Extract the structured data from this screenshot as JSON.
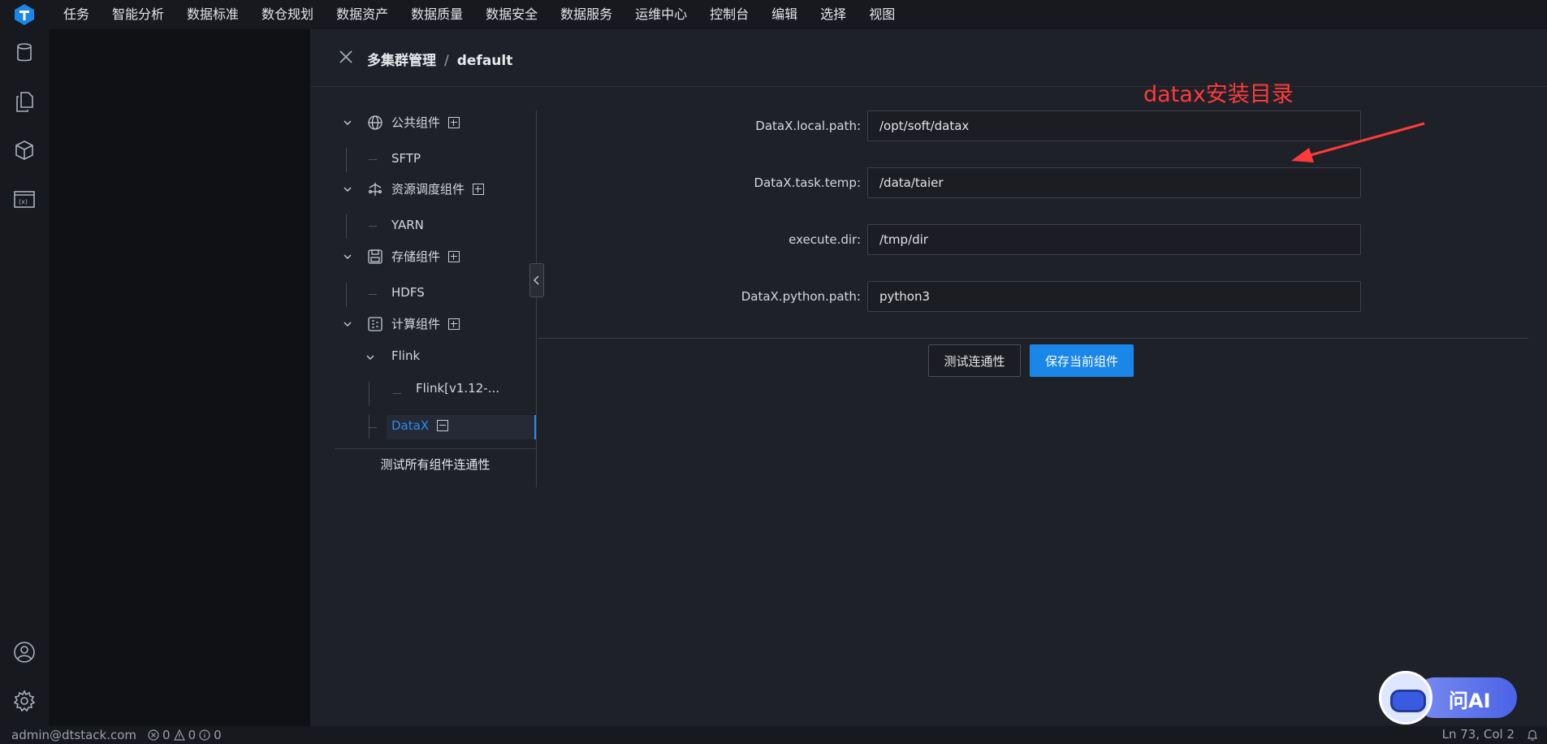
{
  "menubar": {
    "logo_icon": "taier-logo-icon",
    "items": [
      "任务",
      "智能分析",
      "数据标准",
      "数仓规划",
      "数据资产",
      "数据质量",
      "数据安全",
      "数据服务",
      "运维中心",
      "控制台",
      "编辑",
      "选择",
      "视图"
    ]
  },
  "activitybar": {
    "top_icons": [
      "database-icon",
      "files-icon",
      "package-icon",
      "variable-icon"
    ],
    "bottom_icons": [
      "account-icon",
      "settings-gear-icon"
    ]
  },
  "header": {
    "breadcrumb_root": "多集群管理",
    "breadcrumb_sep": "/",
    "breadcrumb_current": "default"
  },
  "tree": {
    "groups": [
      {
        "label": "公共组件",
        "icon": "globe-icon",
        "children": [
          "SFTP"
        ]
      },
      {
        "label": "资源调度组件",
        "icon": "resource-schedule-icon",
        "children": [
          "YARN"
        ]
      },
      {
        "label": "存储组件",
        "icon": "save-disk-icon",
        "children": [
          "HDFS"
        ]
      },
      {
        "label": "计算组件",
        "icon": "compute-icon",
        "children": []
      }
    ],
    "flink_label": "Flink",
    "flink_child": "Flink[v1.12-...",
    "datax_label": "DataX",
    "test_all_label": "测试所有组件连通性",
    "accent_color": "#2b8bf0"
  },
  "form": {
    "fields": [
      {
        "label": "DataX.local.path:",
        "value": "/opt/soft/datax"
      },
      {
        "label": "DataX.task.temp:",
        "value": "/data/taier"
      },
      {
        "label": "execute.dir:",
        "value": "/tmp/dir"
      },
      {
        "label": "DataX.python.path:",
        "value": "python3"
      }
    ],
    "test_button": "测试连通性",
    "save_button": "保存当前组件",
    "save_color": "#1a86e8"
  },
  "annotation": {
    "text": "datax安装目录",
    "color": "#ff3a3a"
  },
  "ask_ai": {
    "label": "问AI"
  },
  "statusbar": {
    "user": "admin@dtstack.com",
    "errors": "0",
    "warnings": "0",
    "infos": "0",
    "position": "Ln 73, Col 2"
  }
}
